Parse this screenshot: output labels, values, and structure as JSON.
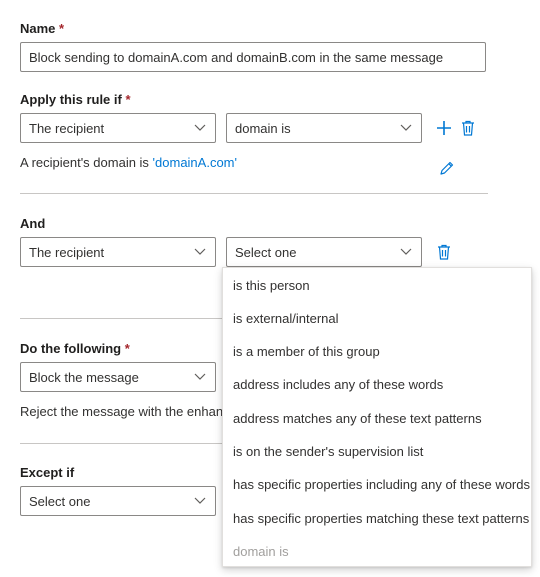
{
  "name": {
    "label": "Name",
    "required_mark": "*",
    "value": "Block sending to domainA.com and domainB.com in the same message"
  },
  "apply_rule": {
    "label": "Apply this rule if",
    "required_mark": "*",
    "condition": "The recipient",
    "operator": "domain is",
    "summary_prefix": "A recipient's domain is ",
    "summary_value": "'domainA.com'"
  },
  "and": {
    "label": "And",
    "condition": "The recipient",
    "operator_placeholder": "Select one"
  },
  "do_following": {
    "label": "Do the following",
    "required_mark": "*",
    "action": "Block the message",
    "summary": "Reject the message with the enhanc"
  },
  "except": {
    "label": "Except if",
    "value": "Select one"
  },
  "dropdown": {
    "options": [
      {
        "label": "is this person",
        "disabled": false
      },
      {
        "label": "is external/internal",
        "disabled": false
      },
      {
        "label": "is a member of this group",
        "disabled": false
      },
      {
        "label": "address includes any of these words",
        "disabled": false
      },
      {
        "label": "address matches any of these text patterns",
        "disabled": false
      },
      {
        "label": "is on the sender's supervision list",
        "disabled": false
      },
      {
        "label": "has specific properties including any of these words",
        "disabled": false
      },
      {
        "label": "has specific properties matching these text patterns",
        "disabled": false
      },
      {
        "label": "domain is",
        "disabled": true
      }
    ]
  },
  "colors": {
    "accent": "#0078d4",
    "required": "#a4262c",
    "border": "#8a8886",
    "disabled_text": "#a19f9d"
  },
  "icons": {
    "chevron": "chevron-down-icon",
    "add": "add-icon",
    "delete": "trash-icon",
    "edit": "pencil-icon"
  }
}
